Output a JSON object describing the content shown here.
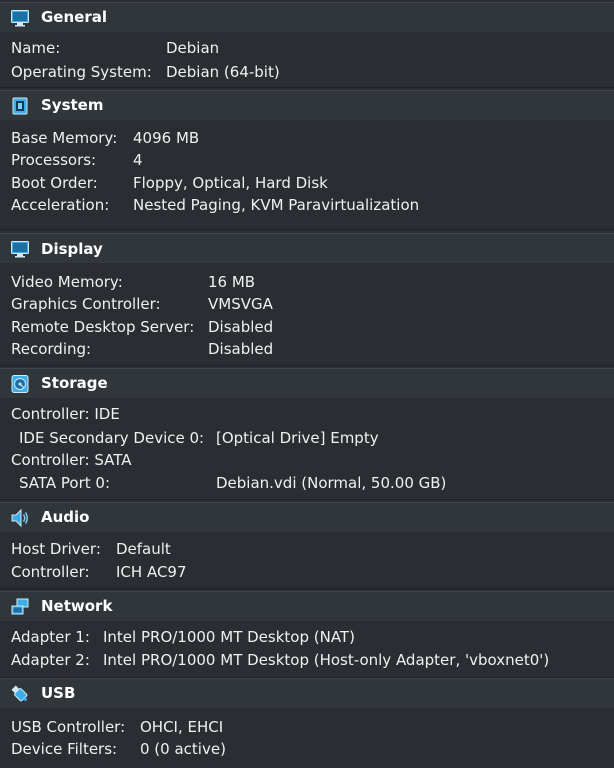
{
  "colors": {
    "background": "#2a2e32",
    "header_background": "#31363b",
    "text": "#eff0f1",
    "accent": "#3daee9"
  },
  "general": {
    "title": "General",
    "icon": "monitor-icon",
    "rows": [
      {
        "label": "Name:",
        "value": "Debian"
      },
      {
        "label": "Operating System:",
        "value": "Debian (64-bit)"
      }
    ]
  },
  "system": {
    "title": "System",
    "icon": "chip-icon",
    "rows": [
      {
        "label": "Base Memory:",
        "value": "4096 MB"
      },
      {
        "label": "Processors:",
        "value": "4"
      },
      {
        "label": "Boot Order:",
        "value": "Floppy, Optical, Hard Disk"
      },
      {
        "label": "Acceleration:",
        "value": "Nested Paging, KVM Paravirtualization"
      }
    ]
  },
  "display": {
    "title": "Display",
    "icon": "display-icon",
    "rows": [
      {
        "label": "Video Memory:",
        "value": "16 MB"
      },
      {
        "label": "Graphics Controller:",
        "value": "VMSVGA"
      },
      {
        "label": "Remote Desktop Server:",
        "value": "Disabled"
      },
      {
        "label": "Recording:",
        "value": "Disabled"
      }
    ]
  },
  "storage": {
    "title": "Storage",
    "icon": "disk-icon",
    "rows": [
      {
        "label": "Controller: IDE",
        "value": ""
      },
      {
        "label": "IDE Secondary Device 0:",
        "value": "[Optical Drive] Empty"
      },
      {
        "label": "Controller: SATA",
        "value": ""
      },
      {
        "label": "SATA Port 0:",
        "value": "Debian.vdi (Normal, 50.00 GB)"
      }
    ]
  },
  "audio": {
    "title": "Audio",
    "icon": "speaker-icon",
    "rows": [
      {
        "label": "Host Driver:",
        "value": "Default"
      },
      {
        "label": "Controller:",
        "value": "ICH AC97"
      }
    ]
  },
  "network": {
    "title": "Network",
    "icon": "network-icon",
    "rows": [
      {
        "label": "Adapter 1:",
        "value": "Intel PRO/1000 MT Desktop (NAT)"
      },
      {
        "label": "Adapter 2:",
        "value": "Intel PRO/1000 MT Desktop (Host-only Adapter, 'vboxnet0')"
      }
    ]
  },
  "usb": {
    "title": "USB",
    "icon": "usb-icon",
    "rows": [
      {
        "label": "USB Controller:",
        "value": "OHCI, EHCI"
      },
      {
        "label": "Device Filters:",
        "value": "0 (0 active)"
      }
    ]
  }
}
